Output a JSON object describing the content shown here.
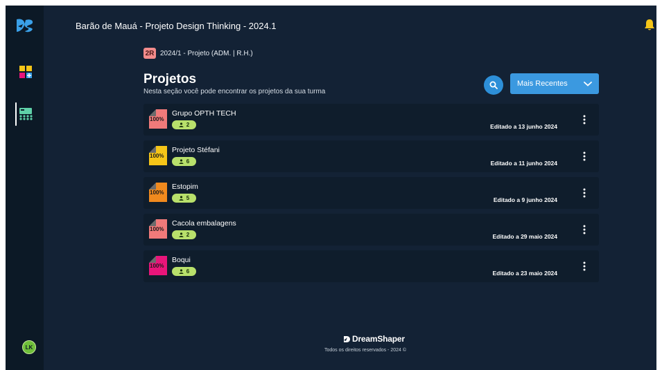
{
  "header": {
    "title": "Barão de Mauá - Projeto Design Thinking - 2024.1"
  },
  "sidebar": {
    "logo_icon": "ds-logo-icon",
    "items": [
      {
        "name": "apps-add-icon",
        "active": false
      },
      {
        "name": "class-board-icon",
        "active": true
      }
    ],
    "avatar_initials": "LK"
  },
  "class_selector": {
    "badge": "2R",
    "label": "2024/1 - Projeto (ADM. | R.H.)"
  },
  "page": {
    "title": "Projetos",
    "subtitle": "Nesta seção você pode encontrar os projetos da sua turma"
  },
  "toolbar": {
    "search_icon": "search-icon",
    "sort_label": "Mais Recentes"
  },
  "projects": [
    {
      "name": "Grupo OPTH TECH",
      "progress": "100%",
      "members": "2",
      "edited": "Editado a 13 junho 2024",
      "color": "#f07a7a"
    },
    {
      "name": "Projeto Stéfani",
      "progress": "100%",
      "members": "6",
      "edited": "Editado a 11 junho 2024",
      "color": "#f5c518"
    },
    {
      "name": "Estopim",
      "progress": "100%",
      "members": "5",
      "edited": "Editado a 9 junho 2024",
      "color": "#f08a1e"
    },
    {
      "name": "Cacola embalagens",
      "progress": "100%",
      "members": "2",
      "edited": "Editado a 29 maio 2024",
      "color": "#f07a7a"
    },
    {
      "name": "Boqui",
      "progress": "100%",
      "members": "6",
      "edited": "Editado a 23 maio 2024",
      "color": "#e8157a"
    }
  ],
  "footer": {
    "brand": "DreamShaper",
    "copyright": "Todos os direitos reservados - 2024 ©"
  },
  "colors": {
    "background": "#132235",
    "sidebar": "#0c1926",
    "card": "#0f1d2c",
    "accent": "#3b99e0",
    "members_pill": "#b8e06b",
    "bell": "#f5c518"
  }
}
